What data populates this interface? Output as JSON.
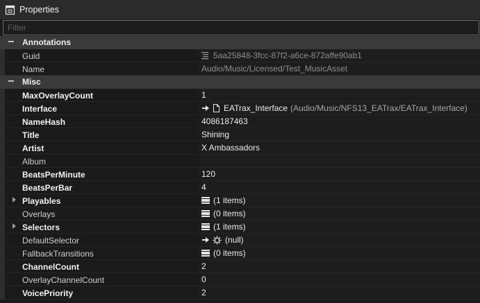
{
  "window": {
    "title": "Properties"
  },
  "filter": {
    "placeholder": "Filter",
    "value": ""
  },
  "categories": {
    "annotations": {
      "toggle": "−",
      "label": "Annotations"
    },
    "misc": {
      "toggle": "−",
      "label": "Misc"
    }
  },
  "props": {
    "guid": {
      "name": "Guid",
      "value": "5aa25848-3fcc-87f2-a6ce-872affe90ab1"
    },
    "name": {
      "name": "Name",
      "value": "Audio/Music/Licensed/Test_MusicAsset"
    },
    "maxOverlayCount": {
      "name": "MaxOverlayCount",
      "value": "1"
    },
    "interface": {
      "name": "Interface",
      "value": "EATrax_Interface",
      "path": "(Audio/Music/NFS13_EATrax/EATrax_Interface)"
    },
    "nameHash": {
      "name": "NameHash",
      "value": "4086187463"
    },
    "title": {
      "name": "Title",
      "value": "Shining"
    },
    "artist": {
      "name": "Artist",
      "value": "X Ambassadors"
    },
    "album": {
      "name": "Album",
      "value": ""
    },
    "beatsPerMinute": {
      "name": "BeatsPerMinute",
      "value": "120"
    },
    "beatsPerBar": {
      "name": "BeatsPerBar",
      "value": "4"
    },
    "playables": {
      "name": "Playables",
      "value": "(1 items)"
    },
    "overlays": {
      "name": "Overlays",
      "value": "(0 items)"
    },
    "selectors": {
      "name": "Selectors",
      "value": "(1 items)"
    },
    "defaultSelector": {
      "name": "DefaultSelector",
      "value": "(null)"
    },
    "fallbackTransitions": {
      "name": "FallbackTransitions",
      "value": "(0 items)"
    },
    "channelCount": {
      "name": "ChannelCount",
      "value": "2"
    },
    "overlayChannelCount": {
      "name": "OverlayChannelCount",
      "value": "0"
    },
    "voicePriority": {
      "name": "VoicePriority",
      "value": "2"
    }
  },
  "icons": {
    "window": "properties-icon",
    "list": "list-icon",
    "arrow": "arrow-right-icon",
    "file": "file-icon",
    "gear": "gear-icon"
  },
  "colors": {
    "background": "#1b1b1b",
    "category": "#3a3a3a",
    "titlebar": "#2b2b2b",
    "text": "#e6e6e6",
    "dimText": "#8f8f8f"
  }
}
